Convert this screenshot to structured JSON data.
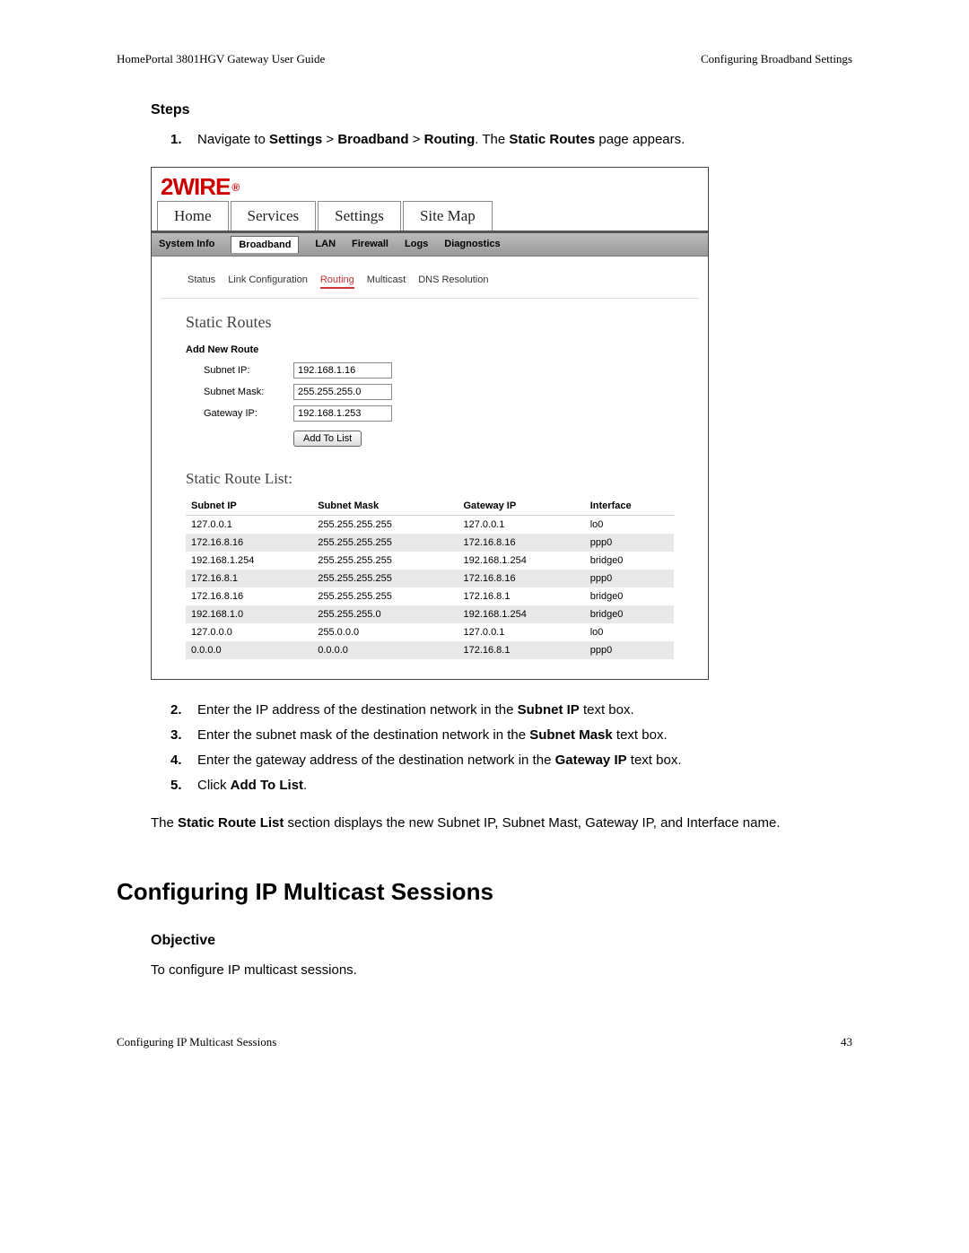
{
  "header": {
    "left": "HomePortal 3801HGV Gateway User Guide",
    "right": "Configuring Broadband Settings"
  },
  "steps_heading": "Steps",
  "step1": {
    "num": "1.",
    "pre": "Navigate to ",
    "b1": "Settings",
    "sep1": " > ",
    "b2": "Broadband",
    "sep2": " > ",
    "b3": "Routing",
    "post1": ". The ",
    "b4": "Static Routes",
    "post2": " page appears."
  },
  "shot": {
    "logo": "2WIRE",
    "tabs1": [
      "Home",
      "Services",
      "Settings",
      "Site Map"
    ],
    "tabs1_active_index": 2,
    "tabs2": [
      "System Info",
      "Broadband",
      "LAN",
      "Firewall",
      "Logs",
      "Diagnostics"
    ],
    "tabs2_active_index": 1,
    "subtabs": [
      "Status",
      "Link Configuration",
      "Routing",
      "Multicast",
      "DNS Resolution"
    ],
    "subtabs_active_index": 2,
    "sr_title": "Static Routes",
    "add_h": "Add New Route",
    "labels": {
      "subnet_ip": "Subnet IP:",
      "subnet_mask": "Subnet Mask:",
      "gateway_ip": "Gateway IP:"
    },
    "values": {
      "subnet_ip": "192.168.1.16",
      "subnet_mask": "255.255.255.0",
      "gateway_ip": "192.168.1.253"
    },
    "add_btn": "Add To List",
    "list_title": "Static Route List:",
    "cols": [
      "Subnet IP",
      "Subnet Mask",
      "Gateway IP",
      "Interface"
    ],
    "rows": [
      [
        "127.0.0.1",
        "255.255.255.255",
        "127.0.0.1",
        "lo0"
      ],
      [
        "172.16.8.16",
        "255.255.255.255",
        "172.16.8.16",
        "ppp0"
      ],
      [
        "192.168.1.254",
        "255.255.255.255",
        "192.168.1.254",
        "bridge0"
      ],
      [
        "172.16.8.1",
        "255.255.255.255",
        "172.16.8.16",
        "ppp0"
      ],
      [
        "172.16.8.16",
        "255.255.255.255",
        "172.16.8.1",
        "bridge0"
      ],
      [
        "192.168.1.0",
        "255.255.255.0",
        "192.168.1.254",
        "bridge0"
      ],
      [
        "127.0.0.0",
        "255.0.0.0",
        "127.0.0.1",
        "lo0"
      ],
      [
        "0.0.0.0",
        "0.0.0.0",
        "172.16.8.1",
        "ppp0"
      ]
    ]
  },
  "steps_after": [
    {
      "num": "2.",
      "pre": "Enter the IP address of the destination network in the ",
      "b": "Subnet IP",
      "post": " text box."
    },
    {
      "num": "3.",
      "pre": "Enter the subnet mask of the destination network in the ",
      "b": "Subnet Mask",
      "post": " text box."
    },
    {
      "num": "4.",
      "pre": "Enter the gateway address of the destination network in the ",
      "b": "Gateway IP",
      "post": " text box."
    },
    {
      "num": "5.",
      "pre": "Click ",
      "b": "Add To List",
      "post": "."
    }
  ],
  "para": {
    "pre": "The ",
    "b": "Static Route List",
    "post": " section displays the new Subnet IP, Subnet Mast, Gateway IP, and Interface name."
  },
  "h1": "Configuring IP Multicast Sessions",
  "obj_h": "Objective",
  "obj_txt": "To configure IP multicast sessions.",
  "footer": {
    "left": "Configuring IP Multicast Sessions",
    "right": "43"
  }
}
